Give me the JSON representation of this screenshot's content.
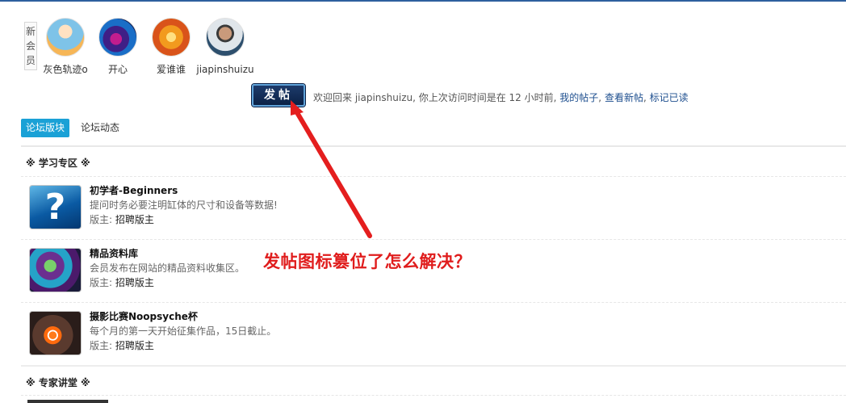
{
  "new_members": {
    "label": "新会员",
    "members": [
      {
        "name": "灰色轨迹o"
      },
      {
        "name": "开心"
      },
      {
        "name": "爱谁谁"
      },
      {
        "name": "jiapinshuizu"
      }
    ]
  },
  "post_button": {
    "label": "发帖"
  },
  "welcome": {
    "text": "欢迎回来 jiapinshuizu, 你上次访问时间是在 12 小时前,",
    "links": [
      "我的帖子",
      "查看新帖",
      "标记已读"
    ],
    "sep": ","
  },
  "tabs": [
    {
      "label": "论坛版块",
      "active": true
    },
    {
      "label": "论坛动态",
      "active": false
    }
  ],
  "sections": [
    {
      "title": "※ 学习专区 ※",
      "forums": [
        {
          "icon": "question-icon",
          "title": "初学者-Beginners",
          "desc": "提问时务必要注明缸体的尺寸和设备等数据!",
          "mod_label": "版主:",
          "mod": "招聘版主"
        },
        {
          "icon": "coral-icon",
          "title": "精品资料库",
          "desc": "会员发布在网站的精品资料收集区。",
          "mod_label": "版主:",
          "mod": "招聘版主"
        },
        {
          "icon": "clownfish-icon",
          "title": "摄影比赛Noopsyche杯",
          "desc": "每个月的第一天开始征集作品，15日截止。",
          "mod_label": "版主:",
          "mod": "招聘版主"
        }
      ]
    },
    {
      "title": "※ 专家讲堂 ※",
      "forums": []
    }
  ],
  "annotation": {
    "text": "发帖图标篡位了怎么解决？",
    "color": "#e01d1d"
  },
  "colors": {
    "accent": "#1aa1d6",
    "link": "#1e4f8f",
    "button_bg": "#0b2146"
  }
}
